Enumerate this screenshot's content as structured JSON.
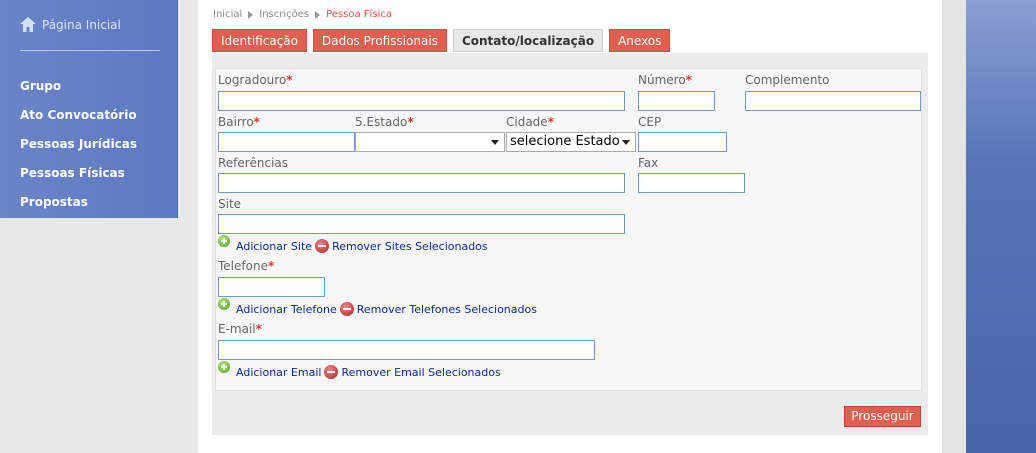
{
  "sidebar": {
    "home_label": "Página Inicial",
    "items": [
      {
        "label": "Grupo"
      },
      {
        "label": "Ato Convocatório"
      },
      {
        "label": "Pessoas Jurídicas"
      },
      {
        "label": "Pessoas Físicas"
      },
      {
        "label": "Propostas"
      }
    ]
  },
  "breadcrumb": {
    "items": [
      "Inicial",
      "Inscrições",
      "Pessoa Física"
    ]
  },
  "tabs": [
    {
      "label": "Identificação",
      "active": false
    },
    {
      "label": "Dados Profissionais",
      "active": false
    },
    {
      "label": "Contato/localização",
      "active": true
    },
    {
      "label": "Anexos",
      "active": false
    }
  ],
  "form": {
    "logradouro": {
      "label": "Logradouro",
      "value": ""
    },
    "numero": {
      "label": "Número",
      "value": ""
    },
    "complemento": {
      "label": "Complemento",
      "value": ""
    },
    "bairro": {
      "label": "Bairro",
      "value": ""
    },
    "estado": {
      "label": "5.Estado",
      "value": ""
    },
    "cidade": {
      "label": "Cidade",
      "value": "selecione Estado"
    },
    "cep": {
      "label": "CEP",
      "value": ""
    },
    "referencias": {
      "label": "Referências",
      "value": ""
    },
    "fax": {
      "label": "Fax",
      "value": ""
    },
    "site": {
      "label": "Site",
      "value": "",
      "add_label": "Adicionar Site",
      "remove_label": "Remover Sites Selecionados"
    },
    "telefone": {
      "label": "Telefone",
      "value": "",
      "add_label": "Adicionar Telefone",
      "remove_label": "Remover Telefones Selecionados"
    },
    "email": {
      "label": "E-mail",
      "value": "",
      "add_label": "Adicionar Email",
      "remove_label": "Remover Email Selecionados"
    },
    "required_mark": "*"
  },
  "actions": {
    "submit_label": "Prosseguir"
  },
  "colors": {
    "sidebar": "#5d78c2",
    "tab": "#e0604f",
    "accent_link": "#0b2a9e"
  }
}
